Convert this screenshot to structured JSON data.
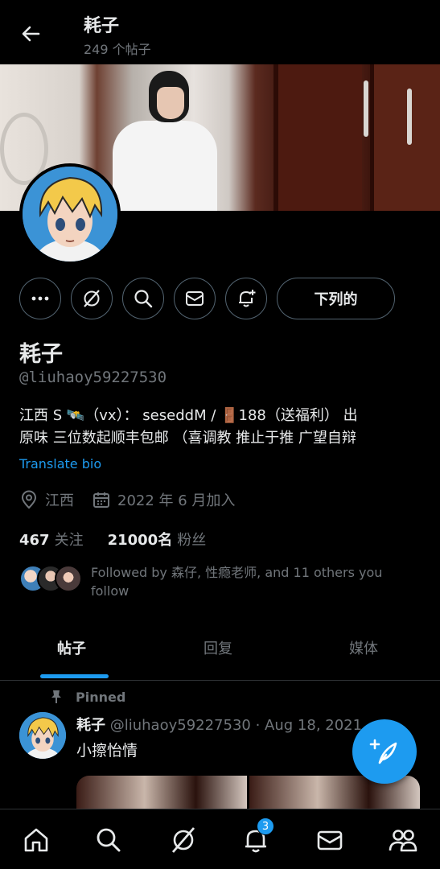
{
  "header": {
    "title": "耗子",
    "post_count": "249 个帖子"
  },
  "profile": {
    "name": "耗子",
    "handle": "@liuhaoy59227530",
    "bio_line1": "江西 S 🛰️（vx）： seseddM / 🚪188（送福利） 出",
    "bio_line2": "原味 三位数起顺丰包邮 （喜调教 推止于推 广望自辩",
    "translate_label": "Translate bio",
    "location": "江西",
    "joined": "2022 年 6 月加入",
    "following_count": "467",
    "following_label": "关注",
    "followers_count": "21000名",
    "followers_label": "粉丝",
    "followed_by": "Followed by 森仔, 性瘾老师, and 11 others you follow",
    "follow_button_label": "下列的"
  },
  "tabs": [
    {
      "label": "帖子",
      "active": true
    },
    {
      "label": "回复",
      "active": false
    },
    {
      "label": "媒体",
      "active": false
    }
  ],
  "pinned_tweet": {
    "pinned_label": "Pinned",
    "author_name": "耗子",
    "author_handle": "@liuhaoy59227530",
    "date": "· Aug 18, 2021",
    "text": "小擦怡情"
  },
  "bottom_nav": {
    "notification_badge": "3"
  },
  "colors": {
    "accent": "#1d9bf0",
    "background": "#000000",
    "text_primary": "#e7e9ea",
    "text_secondary": "#71767b"
  }
}
